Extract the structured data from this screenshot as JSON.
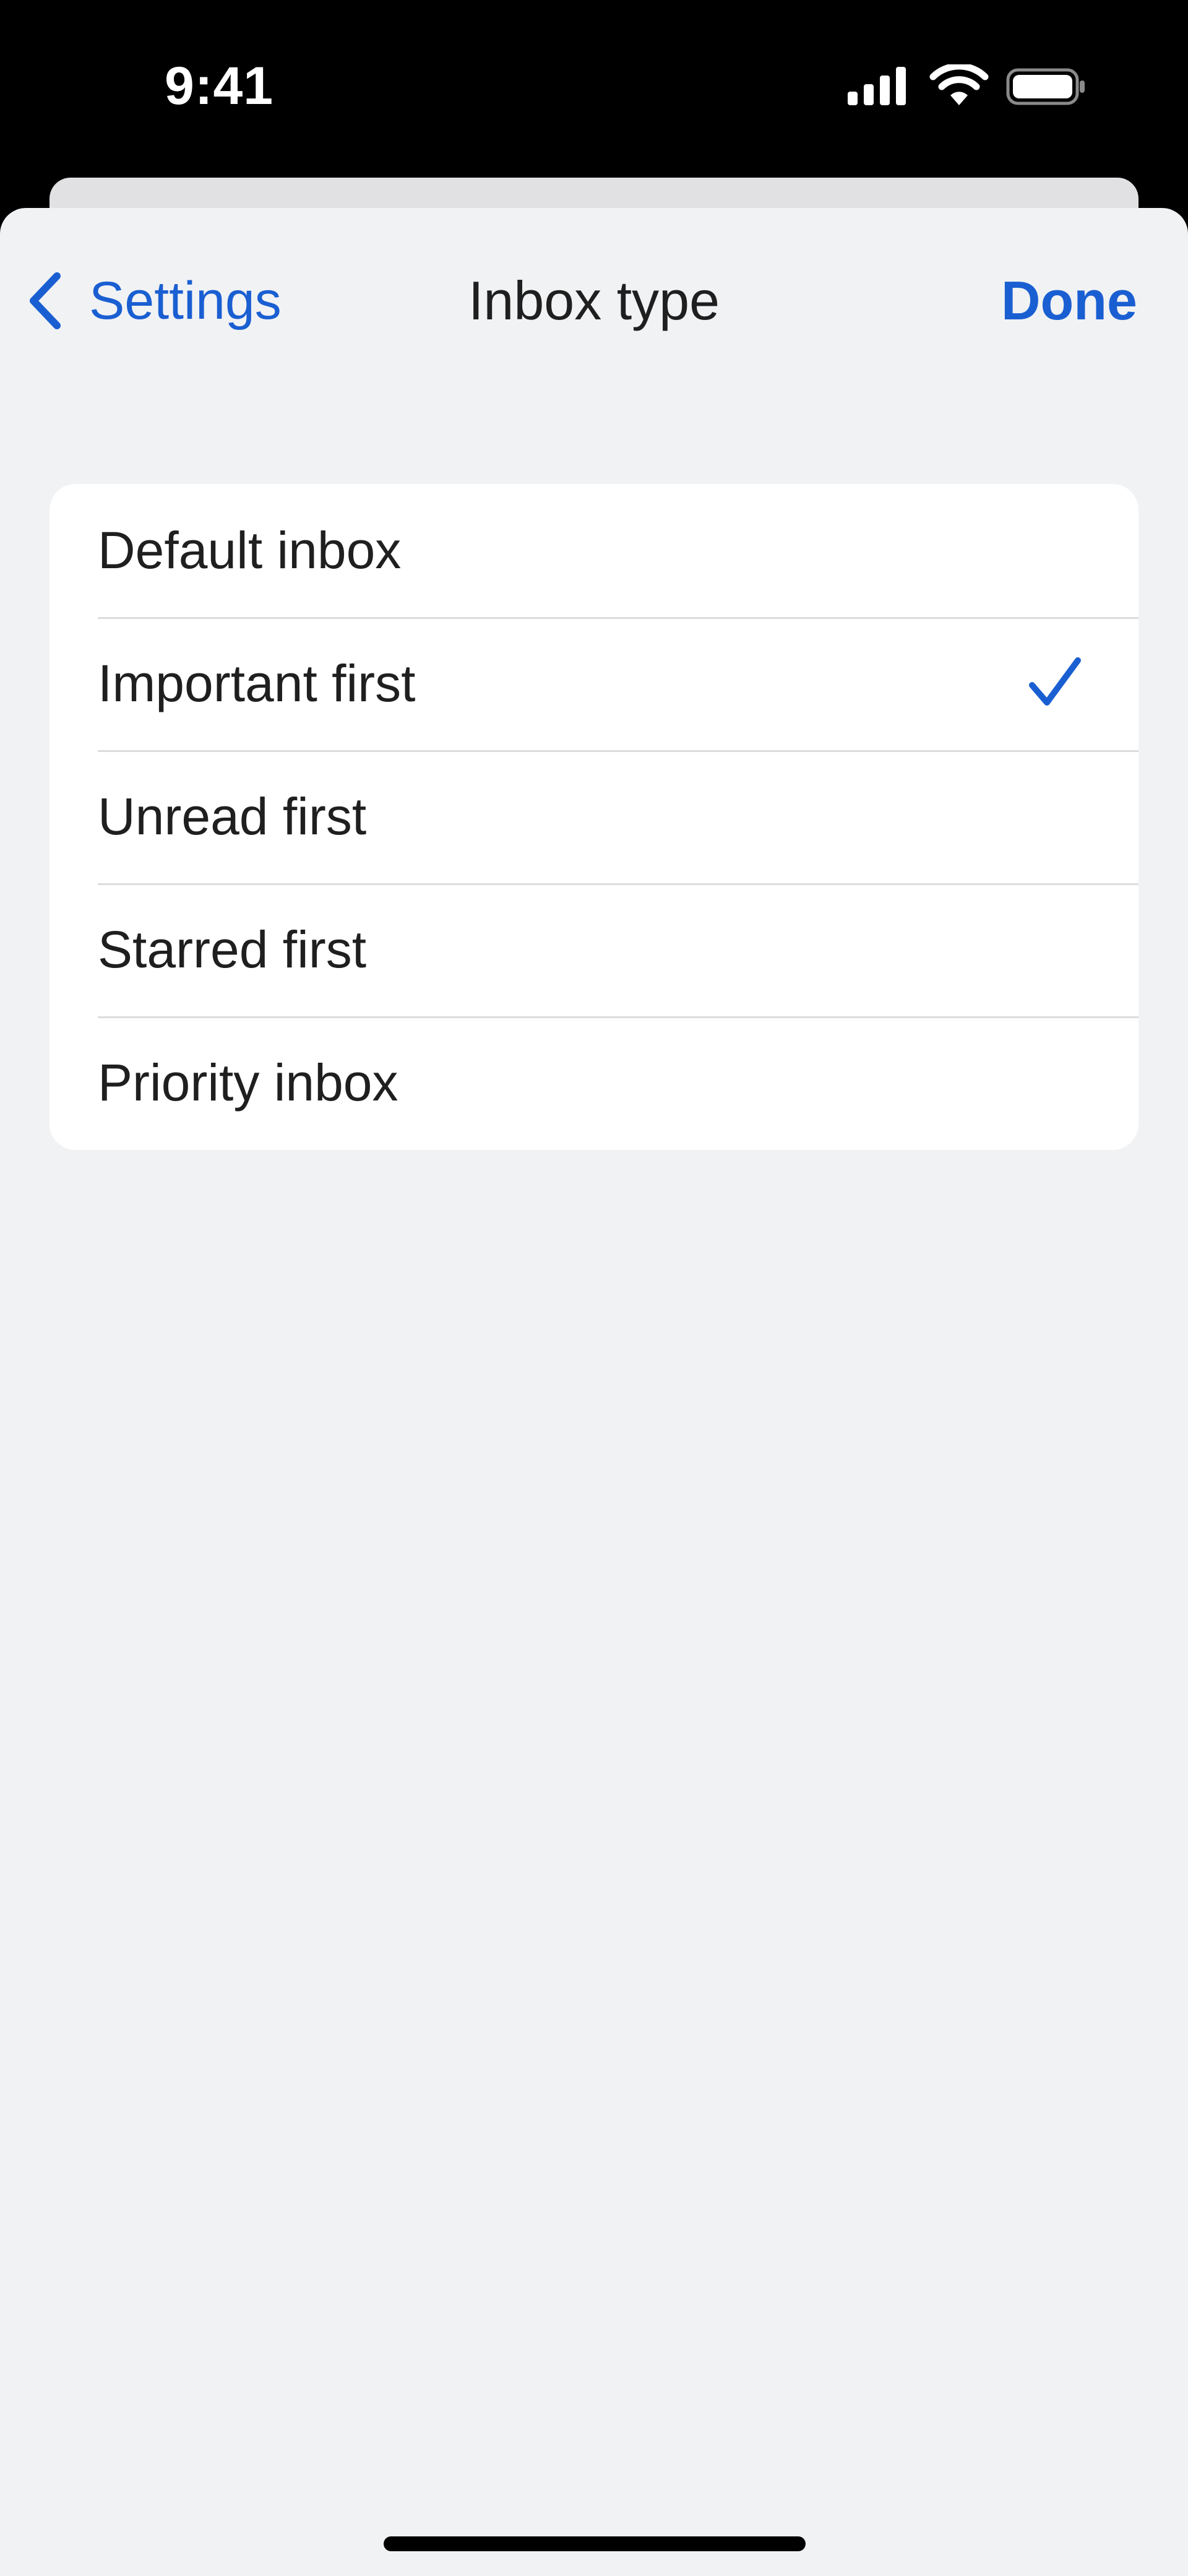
{
  "status_bar": {
    "time": "9:41",
    "icons": [
      "cellular-signal-icon",
      "wifi-icon",
      "battery-icon"
    ]
  },
  "nav": {
    "back_label": "Settings",
    "back_icon": "chevron-left-icon",
    "title": "Inbox type",
    "done_label": "Done"
  },
  "options": [
    {
      "label": "Default inbox",
      "selected": false
    },
    {
      "label": "Important first",
      "selected": true
    },
    {
      "label": "Unread first",
      "selected": false
    },
    {
      "label": "Starred first",
      "selected": false
    },
    {
      "label": "Priority inbox",
      "selected": false
    }
  ],
  "colors": {
    "accent": "#1a5fd2",
    "background": "#f1f2f4",
    "card": "#ffffff",
    "text": "#1f1f1f"
  }
}
